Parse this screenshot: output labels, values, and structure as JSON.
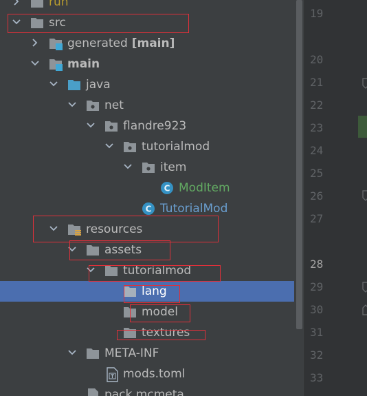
{
  "tree": {
    "items": [
      {
        "label": "run"
      },
      {
        "label": "src"
      },
      {
        "label": "generated",
        "suffix": " [main]"
      },
      {
        "label": "main"
      },
      {
        "label": "java"
      },
      {
        "label": "net"
      },
      {
        "label": "flandre923"
      },
      {
        "label": "tutorialmod"
      },
      {
        "label": "item"
      },
      {
        "label": "ModItem",
        "icon": "class-icon"
      },
      {
        "label": "TutorialMod",
        "icon": "class-icon"
      },
      {
        "label": "resources"
      },
      {
        "label": "assets"
      },
      {
        "label": "tutorialmod"
      },
      {
        "label": "lang"
      },
      {
        "label": "model"
      },
      {
        "label": "textures"
      },
      {
        "label": "META-INF"
      },
      {
        "label": "mods.toml"
      },
      {
        "label": "pack.mcmeta"
      }
    ],
    "class_badge": "C"
  },
  "gutter": {
    "line_numbers": [
      "19",
      "20",
      "21",
      "22",
      "23",
      "24",
      "25",
      "26",
      "27",
      "28",
      "29",
      "30",
      "31",
      "32",
      "33"
    ]
  },
  "colors": {
    "selection": "#4b6eaf",
    "highlight_box": "#e0303a",
    "folder": "#8e9499",
    "java_folder": "#4a9fc8",
    "class_badge": "#3592c4"
  }
}
